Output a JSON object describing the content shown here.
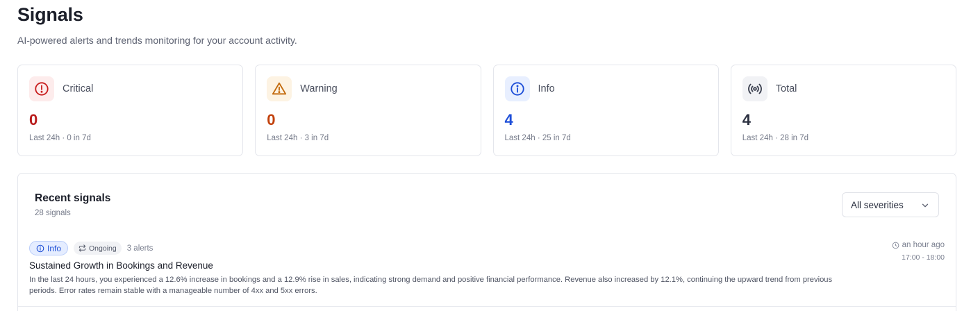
{
  "header": {
    "title": "Signals",
    "subtitle": "AI-powered alerts and trends monitoring for your account activity."
  },
  "cards": [
    {
      "label": "Critical",
      "value": "0",
      "sub": "Last 24h · 0 in 7d",
      "icon": "alert-circle-icon",
      "color": "#b91c1c"
    },
    {
      "label": "Warning",
      "value": "0",
      "sub": "Last 24h · 3 in 7d",
      "icon": "alert-triangle-icon",
      "color": "#c2410c"
    },
    {
      "label": "Info",
      "value": "4",
      "sub": "Last 24h · 25 in 7d",
      "icon": "info-icon",
      "color": "#1d4ed8"
    },
    {
      "label": "Total",
      "value": "4",
      "sub": "Last 24h · 28 in 7d",
      "icon": "broadcast-icon",
      "color": "#2b3040"
    }
  ],
  "recent": {
    "title": "Recent signals",
    "count": "28 signals",
    "filter": {
      "selected": "All severities"
    },
    "signals": [
      {
        "severity": "Info",
        "status": "Ongoing",
        "alerts": "3 alerts",
        "title": "Sustained Growth in Bookings and Revenue",
        "description": "In the last 24 hours, you experienced a 12.6% increase in bookings and a 12.9% rise in sales, indicating strong demand and positive financial performance. Revenue also increased by 12.1%, continuing the upward trend from previous periods. Error rates remain stable with a manageable number of 4xx and 5xx errors.",
        "time_ago": "an hour ago",
        "time_range": "17:00 - 18:00"
      }
    ]
  }
}
